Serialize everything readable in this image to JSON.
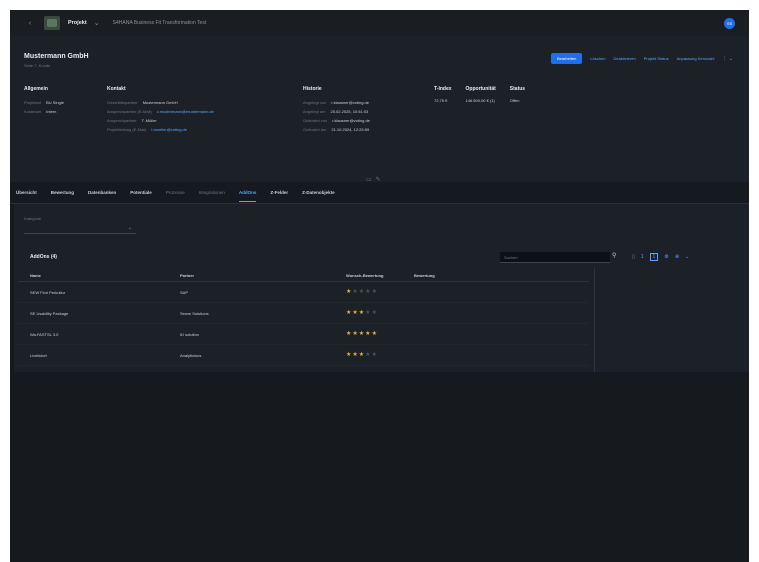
{
  "topbar": {
    "project_label": "Projekt",
    "project_dropdown_icon": "chevron-down-icon",
    "breadcrumb": "S4HANA Business Fit Transformation Test",
    "avatar_initials": "SS"
  },
  "header": {
    "company_name": "Mustermann GmbH",
    "company_sub": "Seite 7, Kunde",
    "actions": {
      "primary": "Bearbeiten",
      "link1": "Löschen",
      "link2": "Deaktivieren",
      "link3": "Projekt Status",
      "link4": "Anpassung Kennzahl"
    },
    "allgemein": {
      "title": "Allgemein",
      "rows": [
        {
          "k": "Projektart",
          "v": "BU Single"
        },
        {
          "k": "Kostenart",
          "v": "Intern"
        }
      ]
    },
    "kontakt": {
      "title": "Kontakt",
      "rows": [
        {
          "k": "Geschäftspartner",
          "v": "Mustermann GmbH",
          "link": false
        },
        {
          "k": "Ansprechpartner (E-Mail)",
          "v": "c.mustermann@mustermann.de",
          "link": true
        },
        {
          "k": "Ansprechpartner",
          "v": "T. Müller",
          "link": false
        },
        {
          "k": "Projektleitung (E-Mail)",
          "v": "t.mueller@voting.de",
          "link": true
        }
      ]
    },
    "historie": {
      "title": "Historie",
      "rows": [
        {
          "k": "Angelegt von",
          "v": "r.klausner@voting.de"
        },
        {
          "k": "Angelegt am",
          "v": "25.02.2025, 10:51:03"
        },
        {
          "k": "Geändert von",
          "v": "r.klausner@voting.de"
        },
        {
          "k": "Geändert am",
          "v": "21.10.2024, 12:25:59"
        }
      ]
    },
    "metrics": [
      {
        "h": "T-Index",
        "v": "72,75 €"
      },
      {
        "h": "Opportunität",
        "v": "146.500,00 € (1)"
      },
      {
        "h": "Status",
        "v": "Offen"
      }
    ]
  },
  "tabs": [
    {
      "label": "Übersicht",
      "active": false,
      "muted": false
    },
    {
      "label": "Bewertung",
      "active": false,
      "muted": false
    },
    {
      "label": "Datenbanken",
      "active": false,
      "muted": false
    },
    {
      "label": "Potentiale",
      "active": false,
      "muted": false
    },
    {
      "label": "Prozesse",
      "active": false,
      "muted": true
    },
    {
      "label": "Integrationen",
      "active": false,
      "muted": true
    },
    {
      "label": "AddOns",
      "active": true,
      "muted": false
    },
    {
      "label": "Z-Felder",
      "active": false,
      "muted": false
    },
    {
      "label": "Z-Datenobjekte",
      "active": false,
      "muted": false
    }
  ],
  "filter": {
    "label": "Kategorie",
    "value": ""
  },
  "table": {
    "title": "AddOns (4)",
    "search_placeholder": "Suchen",
    "tools": {
      "count": "1",
      "filter_value": "1"
    },
    "columns": [
      "Name",
      "Partner",
      "Wunsch-Bewertung",
      "Bewertung"
    ],
    "rows": [
      {
        "name": "SEW Fiori Perkultur",
        "partner": "SAP",
        "stars": 1
      },
      {
        "name": "SE Usability Package",
        "partner": "Sewm Solutions",
        "stars": 3
      },
      {
        "name": "Wa.FASTSL 3.0",
        "partner": "ID solution",
        "stars": 5
      },
      {
        "name": "Liveticket",
        "partner": "Analyticlous",
        "stars": 3
      }
    ]
  },
  "colors": {
    "accent": "#1f6feb",
    "link": "#58a6ff",
    "star": "#e3b341",
    "bg": "#16191d",
    "panel": "#1c2128"
  }
}
